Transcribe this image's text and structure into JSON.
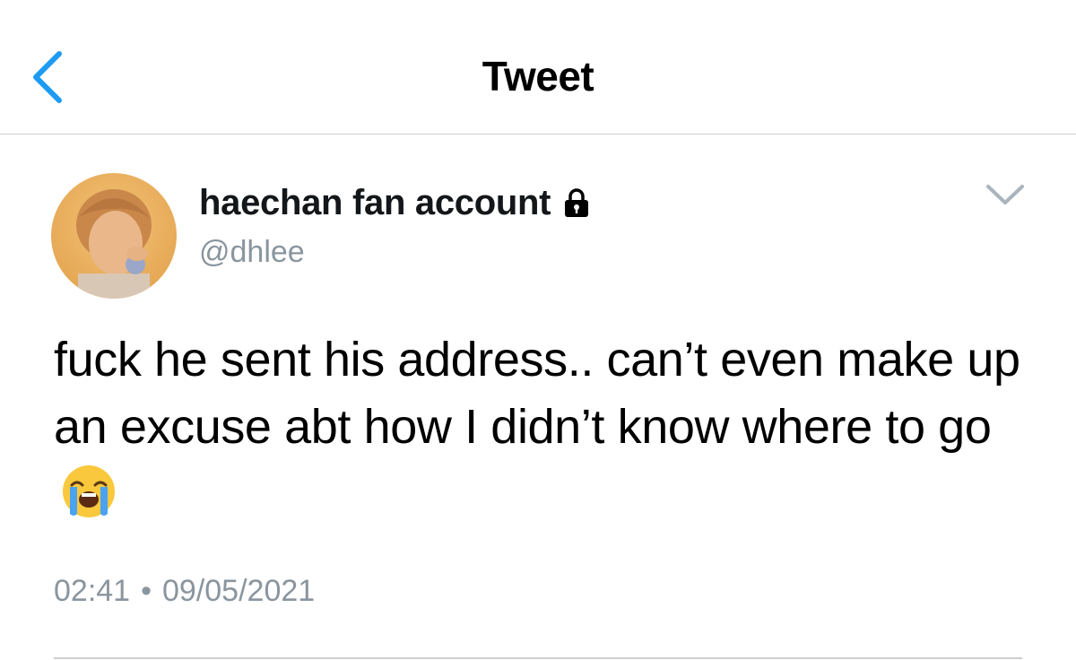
{
  "header": {
    "title": "Tweet",
    "back_icon": "chevron-left-icon"
  },
  "author": {
    "display_name": "haechan fan account",
    "handle": "@dhlee",
    "protected_icon": "lock-icon",
    "avatar": "avatar"
  },
  "tweet": {
    "text": "fuck he sent his address.. can’t even make up an excuse abt how I didn’t know where to go",
    "emoji": "loudly-crying-face-emoji",
    "time": "02:41",
    "separator": "•",
    "date": "09/05/2021"
  },
  "menu": {
    "more_icon": "chevron-down-icon"
  },
  "colors": {
    "accent": "#1d9bf0",
    "secondary_text": "#8a959e",
    "divider": "#cfcfcf"
  }
}
